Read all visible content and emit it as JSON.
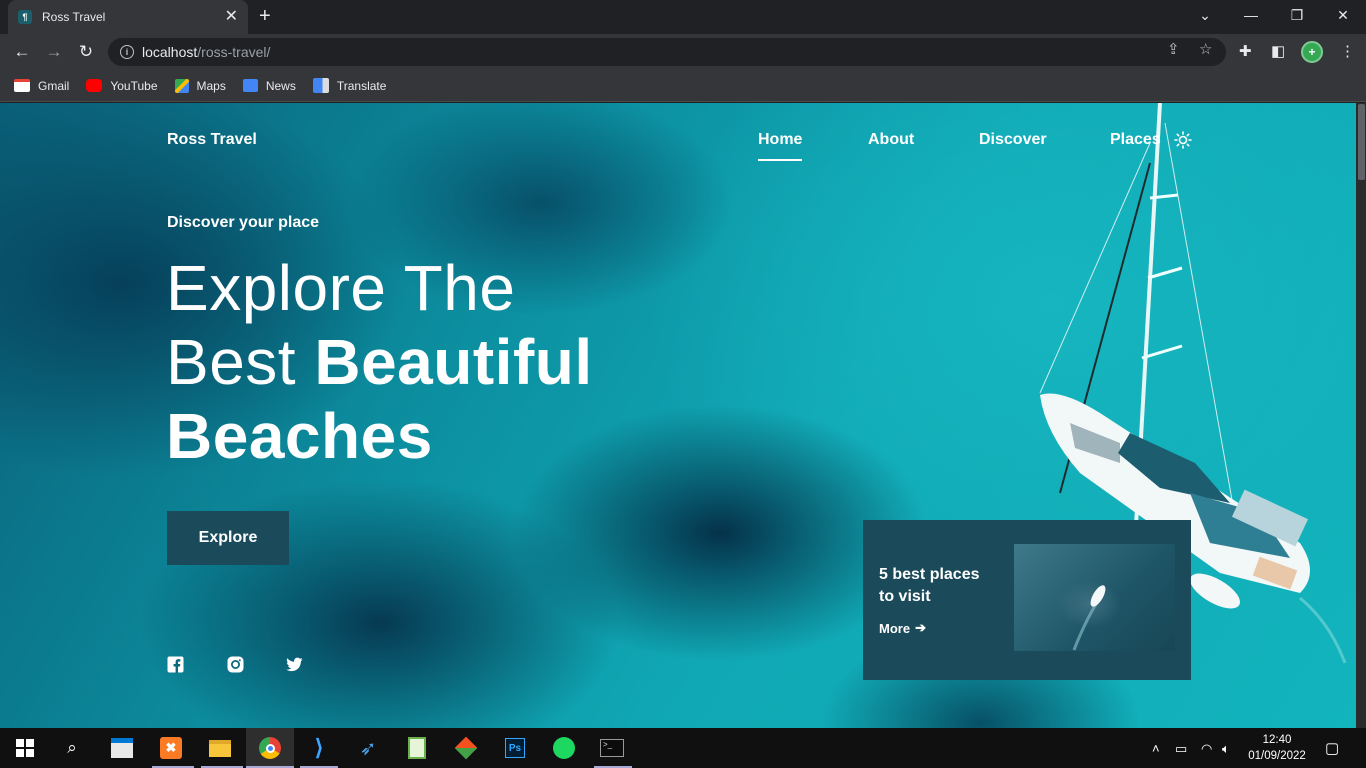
{
  "browser": {
    "tab_title": "Ross Travel",
    "tab_favicon_glyph": "¶",
    "url_host": "localhost",
    "url_path": "/ross-travel/",
    "bookmarks": [
      {
        "label": "Gmail",
        "color": "#ea4335"
      },
      {
        "label": "YouTube",
        "color": "#ff0000"
      },
      {
        "label": "Maps",
        "color": "#34a853"
      },
      {
        "label": "News",
        "color": "#4285f4"
      },
      {
        "label": "Translate",
        "color": "#4285f4"
      }
    ]
  },
  "site": {
    "brand": "Ross Travel",
    "nav": [
      "Home",
      "About",
      "Discover",
      "Places"
    ],
    "active_nav": "Home",
    "eyebrow": "Discover your place",
    "hero_line1": "Explore The",
    "hero_line2_light": "Best ",
    "hero_line2_bold": "Beautiful",
    "hero_line3": "Beaches",
    "cta": "Explore",
    "social": [
      "facebook-icon",
      "instagram-icon",
      "twitter-icon"
    ],
    "card": {
      "title": "5 best places to visit",
      "link": "More"
    },
    "colors": {
      "accent": "#1b4b5a",
      "water": "#10a8b4"
    }
  },
  "taskbar": {
    "time": "12:40",
    "date": "01/09/2022",
    "apps": [
      "start-icon",
      "search-icon",
      "store-icon",
      "xampp-icon",
      "file-explorer-icon",
      "chrome-icon",
      "vscode-icon",
      "dolphin-icon",
      "notepad-icon",
      "git-icon",
      "photoshop-icon",
      "spotify-icon",
      "terminal-icon"
    ]
  }
}
